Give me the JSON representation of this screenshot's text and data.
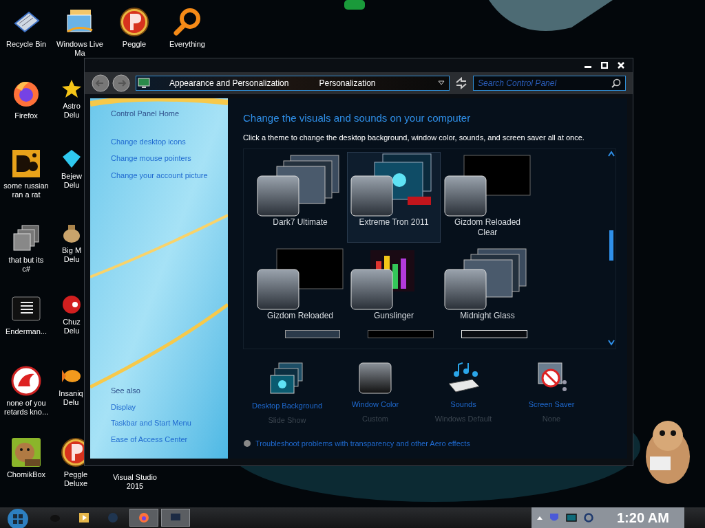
{
  "desktop_icons": [
    {
      "label": "Recycle Bin",
      "kind": "bin"
    },
    {
      "label": "Firefox",
      "kind": "firefox"
    },
    {
      "label": "some russian ran a rat",
      "kind": "de"
    },
    {
      "label": "that but its c#",
      "kind": "stack"
    },
    {
      "label": "Enderman...",
      "kind": "list"
    },
    {
      "label": "none of you retards kno...",
      "kind": "dragon"
    },
    {
      "label": "ChomikBox",
      "kind": "hamster"
    },
    {
      "label": "Windows Live Ma",
      "kind": "mail"
    },
    {
      "label": "Astro Delu",
      "kind": "star"
    },
    {
      "label": "Bejew Delu",
      "kind": "gem"
    },
    {
      "label": "Big M Delu",
      "kind": "bag"
    },
    {
      "label": "Chuz Delu",
      "kind": "ball"
    },
    {
      "label": "Insaniq Delu",
      "kind": "fish"
    },
    {
      "label": "Peggle Deluxe",
      "kind": "peggle"
    },
    {
      "label": "Peggle",
      "kind": "peggle"
    },
    {
      "label": "Everything",
      "kind": "search"
    },
    {
      "label": "Visual Studio 2015",
      "kind": "vs"
    }
  ],
  "window": {
    "address": [
      "Appearance and Personalization",
      "Personalization"
    ],
    "search": {
      "placeholder": "Search Control Panel"
    },
    "left_pane": {
      "home": "Control Panel Home",
      "links": [
        "Change desktop icons",
        "Change mouse pointers",
        "Change your account picture"
      ],
      "see_also_title": "See also",
      "see_also": [
        "Display",
        "Taskbar and Start Menu",
        "Ease of Access Center"
      ]
    },
    "heading": "Change the visuals and sounds on your computer",
    "description": "Click a theme to change the desktop background, window color, sounds, and screen saver all at once.",
    "themes": [
      {
        "name": "Dark7 Ultimate",
        "selected": false,
        "kind": "stack"
      },
      {
        "name": "Extreme Tron 2011",
        "selected": true,
        "kind": "tron"
      },
      {
        "name": "Gizdom Reloaded Clear",
        "selected": false,
        "kind": "black"
      },
      {
        "name": "Gizdom Reloaded",
        "selected": false,
        "kind": "black"
      },
      {
        "name": "Gunslinger",
        "selected": false,
        "kind": "color"
      },
      {
        "name": "Midnight Glass",
        "selected": false,
        "kind": "stack"
      }
    ],
    "settings": [
      {
        "label": "Desktop Background",
        "value": "Slide Show",
        "kind": "background"
      },
      {
        "label": "Window Color",
        "value": "Custom",
        "kind": "color"
      },
      {
        "label": "Sounds",
        "value": "Windows Default",
        "kind": "sounds"
      },
      {
        "label": "Screen Saver",
        "value": "None",
        "kind": "saver"
      }
    ],
    "troubleshoot": "Troubleshoot problems with transparency and other Aero effects"
  },
  "taskbar": {
    "clock": "1:20 AM"
  }
}
